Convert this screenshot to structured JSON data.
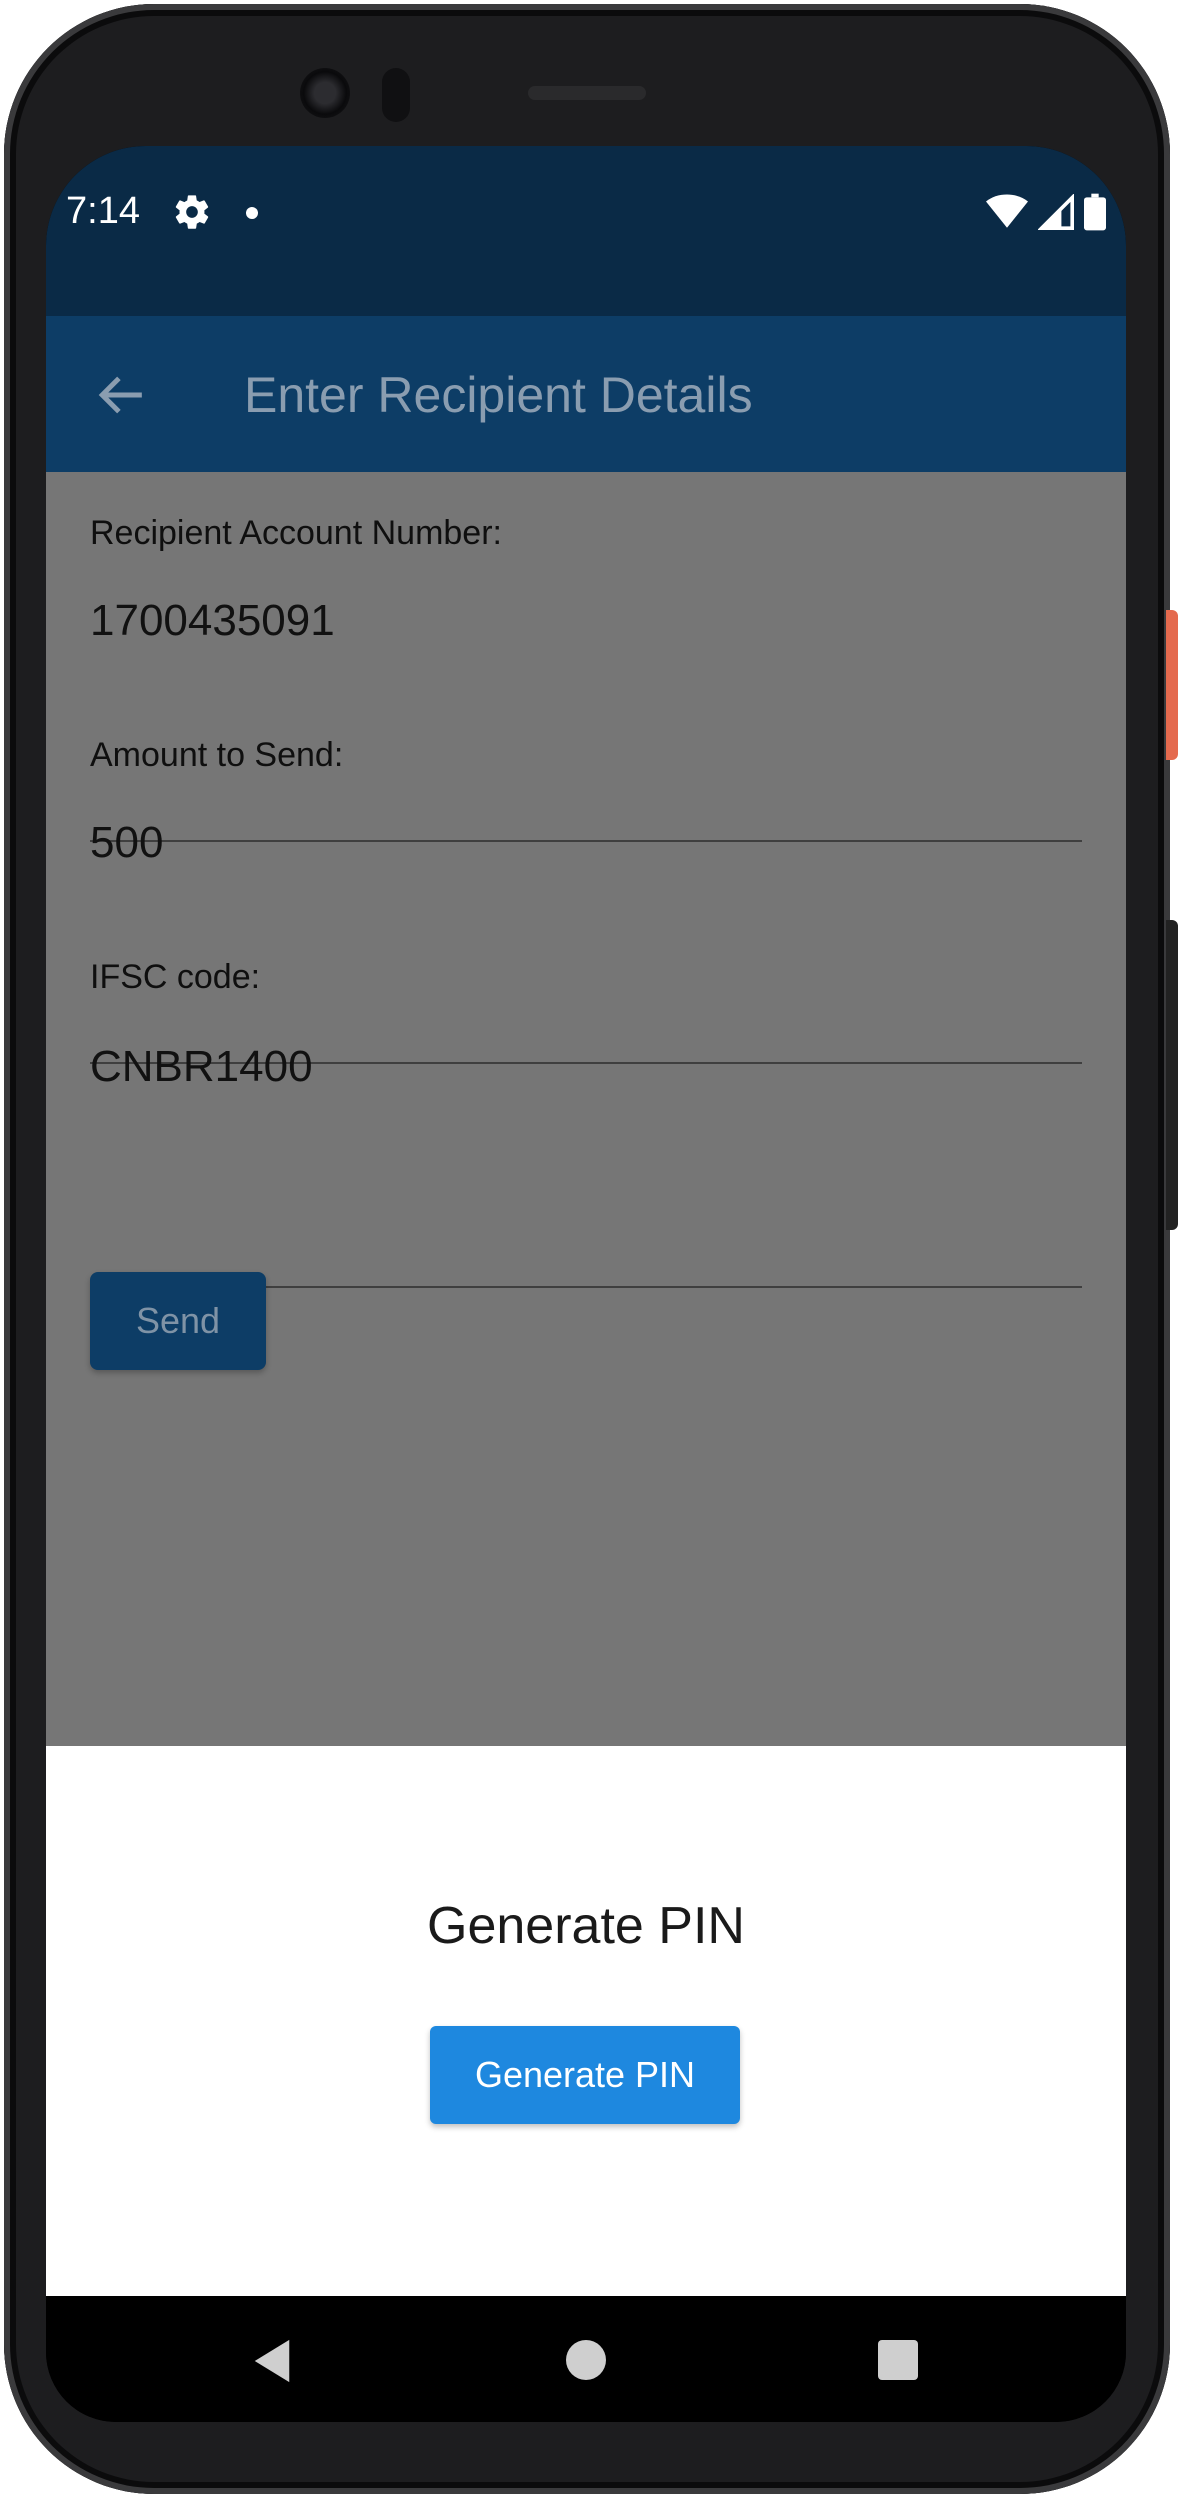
{
  "status_bar": {
    "time": "7:14",
    "icons": [
      "gear-icon",
      "dot-icon",
      "wifi-icon",
      "signal-icon",
      "battery-icon"
    ]
  },
  "app_bar": {
    "title": "Enter Recipient Details",
    "back_icon": "back-arrow-icon"
  },
  "form": {
    "account_label": "Recipient Account Number:",
    "account_value": "1700435091",
    "amount_label": "Amount to Send:",
    "amount_value": "500",
    "ifsc_label": "IFSC code:",
    "ifsc_value": "CNBR1400",
    "send_label": "Send"
  },
  "sheet": {
    "title": "Generate PIN",
    "button_label": "Generate PIN"
  },
  "nav": {
    "icons": [
      "nav-back-icon",
      "nav-home-icon",
      "nav-recents-icon"
    ]
  },
  "colors": {
    "status_bar": "#0a2a46",
    "app_bar": "#0d3d66",
    "scrim_content": "#767676",
    "primary_button": "#1e88df"
  }
}
